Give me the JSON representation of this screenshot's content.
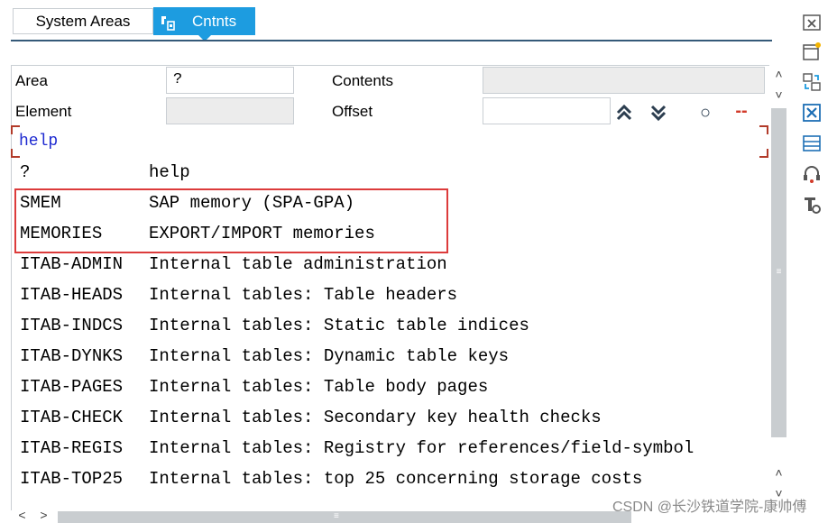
{
  "tabs": {
    "system_areas": "System Areas",
    "contents": "Cntnts"
  },
  "fields": {
    "area_label": "Area",
    "area_value": "?",
    "contents_label": "Contents",
    "contents_value": "",
    "element_label": "Element",
    "element_value": "",
    "offset_label": "Offset",
    "offset_value": ""
  },
  "header_buttons": {
    "circle": "○",
    "dash": "--"
  },
  "help_text": "help",
  "rows": [
    {
      "code": "?",
      "desc": "help"
    },
    {
      "code": "SMEM",
      "desc": "SAP memory (SPA-GPA)"
    },
    {
      "code": "MEMORIES",
      "desc": "EXPORT/IMPORT memories"
    },
    {
      "code": "ITAB-ADMIN",
      "desc": "Internal table administration"
    },
    {
      "code": "ITAB-HEADS",
      "desc": "Internal tables: Table headers"
    },
    {
      "code": "ITAB-INDCS",
      "desc": "Internal tables: Static table indices"
    },
    {
      "code": "ITAB-DYNKS",
      "desc": "Internal tables: Dynamic table keys"
    },
    {
      "code": "ITAB-PAGES",
      "desc": "Internal tables: Table body pages"
    },
    {
      "code": "ITAB-CHECK",
      "desc": "Internal tables: Secondary key health checks"
    },
    {
      "code": "ITAB-REGIS",
      "desc": "Internal tables: Registry for references/field-symbol"
    },
    {
      "code": "ITAB-TOP25",
      "desc": "Internal tables: top 25 concerning storage costs"
    }
  ],
  "scroll": {
    "up": "˄",
    "down": "˅",
    "left": "<",
    "right": ">",
    "grip": "≡"
  },
  "watermark": "CSDN @长沙铁道学院-康帅傅",
  "colors": {
    "accent": "#1d9ce0",
    "link_text": "#1f2bd1",
    "highlight_box": "#dc3b3b"
  },
  "icons": [
    "wrench-icon",
    "close-window-icon",
    "new-window-icon",
    "refresh-icon",
    "close-x-icon",
    "layout-icon",
    "headset-icon",
    "tools-icon"
  ]
}
